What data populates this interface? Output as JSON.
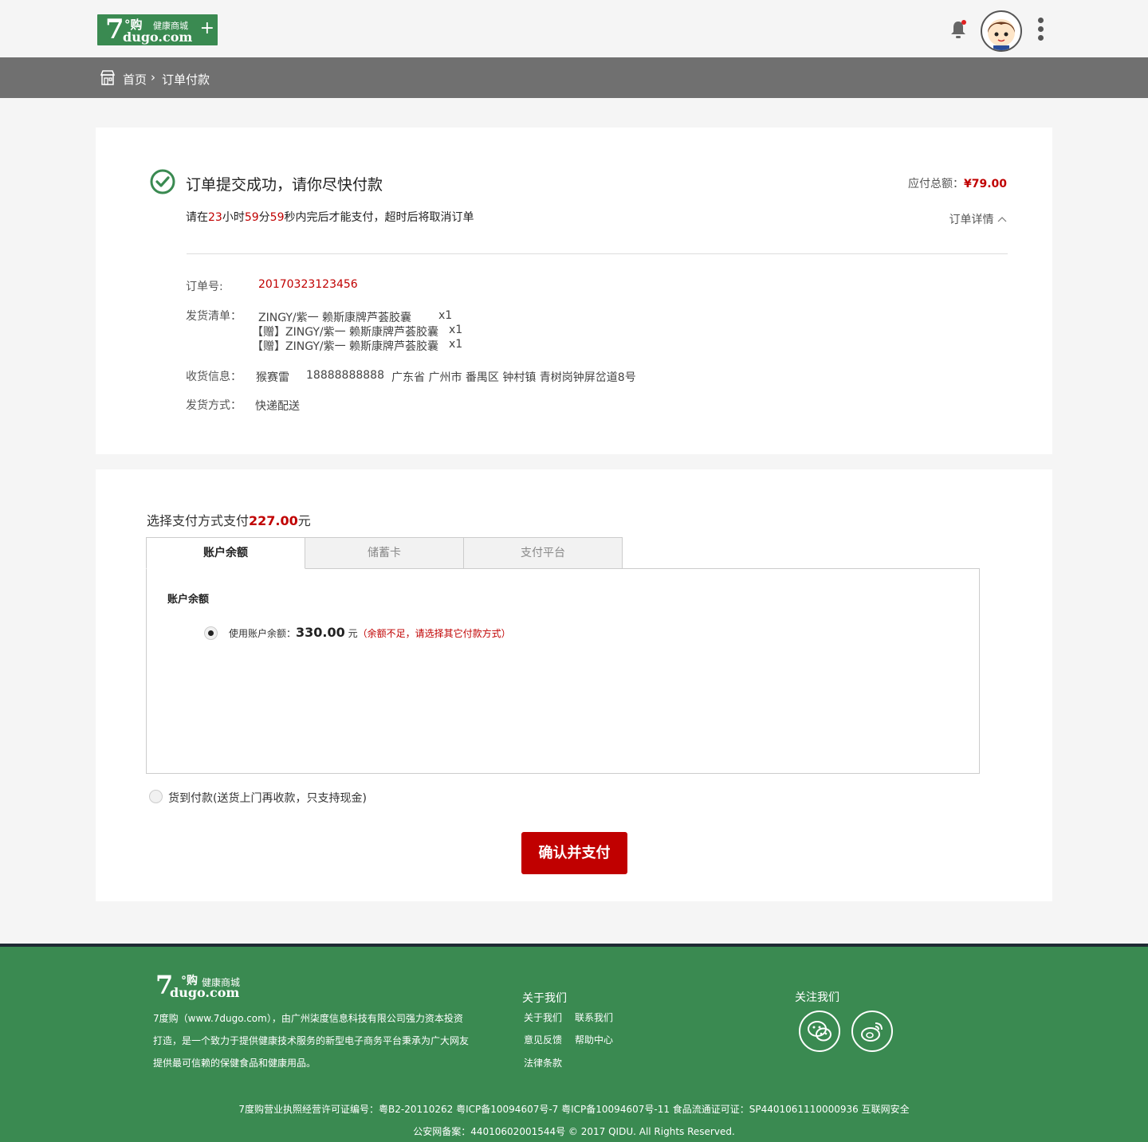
{
  "header": {
    "logo_seven": "7",
    "logo_gou": "°购",
    "logo_domain": "dugo.com",
    "logo_tagline": "健康商城",
    "logo_plus": "+"
  },
  "breadcrumb": {
    "home": "首页",
    "separator": "›",
    "current": "订单付款"
  },
  "order": {
    "success_title": "订单提交成功，请你尽快付款",
    "countdown_prefix": "请在",
    "hours": "23",
    "hours_unit": "小时",
    "minutes": "59",
    "minutes_unit": "分",
    "seconds": "59",
    "countdown_suffix": "秒内完后才能支付，超时后将取消订单",
    "total_label": "应付总额：",
    "total_amount": "¥79.00",
    "detail_link": "订单详情",
    "order_no_label": "订单号:",
    "order_no": "20170323123456",
    "items_label": "发货清单：",
    "items": [
      {
        "name": "ZINGY/紫一 赖斯康牌芦荟胶囊",
        "qty": "x1"
      },
      {
        "name": "【赠】ZINGY/紫一 赖斯康牌芦荟胶囊",
        "qty": "x1"
      },
      {
        "name": "【赠】ZINGY/紫一 赖斯康牌芦荟胶囊",
        "qty": "x1"
      }
    ],
    "receiver_label": "收货信息：",
    "receiver_name": "猴赛雷",
    "receiver_phone": "18888888888",
    "receiver_address": "广东省 广州市 番禺区 钟村镇 青树岗钟屏岔道8号",
    "shipping_label": "发货方式：",
    "shipping_method": "快递配送"
  },
  "payment": {
    "title_prefix": "选择支付方式支付",
    "title_amount": "227.00",
    "title_suffix": "元",
    "tabs": [
      "账户余额",
      "储蓄卡",
      "支付平台"
    ],
    "panel_title": "账户余额",
    "balance_label": "使用账户余额：",
    "balance_value": "330.00",
    "balance_unit": "元",
    "balance_warning": "（余额不足，请选择其它付款方式）",
    "cod_label": "货到付款(送货上门再收款，只支持现金)",
    "confirm_button": "确认并支付"
  },
  "footer": {
    "logo_seven": "7",
    "logo_gou": "°购",
    "logo_domain": "dugo.com",
    "logo_tagline": "健康商城",
    "description": "7度购（www.7dugo.com），由广州柒度信息科技有限公司强力资本投资打造，是一个致力于提供健康技术服务的新型电子商务平台秉承为广大网友提供最可信赖的保健食品和健康用品。",
    "about_title": "关于我们",
    "links": [
      "关于我们",
      "联系我们",
      "意见反馈",
      "帮助中心",
      "法律条款"
    ],
    "follow_title": "关注我们",
    "license_line": "7度购营业执照经营许可证编号：粤B2-20110262    粤ICP备10094607号-7 粤ICP备10094607号-11    食品流通证可证：SP4401061110000936 互联网安全",
    "copyright_line": "公安网备案：44010602001544号  © 2017 QIDU. All Rights Reserved."
  },
  "colors": {
    "brand_green": "#3a8a51",
    "accent_red": "#c00000",
    "breadcrumb_gray": "#707070"
  },
  "icons": [
    "bell-icon",
    "avatar",
    "kebab-menu-icon",
    "store-home-icon",
    "success-check-icon",
    "chevron-up-icon",
    "wechat-icon",
    "weibo-icon"
  ]
}
